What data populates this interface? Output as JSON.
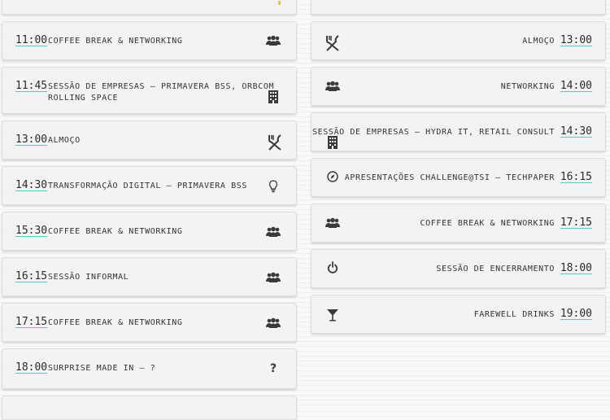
{
  "left": [
    {
      "time": "",
      "label": ""
    },
    {
      "time": "11:00",
      "label": "coffee break & networking",
      "icon": "group-icon"
    },
    {
      "time": "11:45",
      "label_line1": "sessão de empresas – primavera bss, orbcom",
      "label_line2": "rolling space",
      "icon": "building-icon"
    },
    {
      "time": "13:00",
      "label": "almoço",
      "icon": "cutlery-icon"
    },
    {
      "time": "14:30",
      "label": "transformação digital – primavera bss",
      "icon": "lightbulb-icon"
    },
    {
      "time": "15:30",
      "label": "coffee break & networking",
      "icon": "group-icon"
    },
    {
      "time": "16:15",
      "label": "sessão informal",
      "icon": "group-icon"
    },
    {
      "time": "17:15",
      "label": "coffee break & networking",
      "icon": "group-icon"
    },
    {
      "time": "18:00",
      "label": "surprise made in – ?",
      "icon": "question-icon"
    }
  ],
  "right": [
    {
      "time": "13:00",
      "label": "almoço",
      "icon": "cutlery-icon"
    },
    {
      "time": "14:00",
      "label": "networking",
      "icon": "group-icon"
    },
    {
      "time": "14:30",
      "label": "sessão de empresas – hydra it, retail consult",
      "icon": "building-icon"
    },
    {
      "time": "16:15",
      "label": "apresentações challenge@tsi – techpaper",
      "icon": "compass-icon"
    },
    {
      "time": "17:15",
      "label": "coffee break & networking",
      "icon": "group-icon"
    },
    {
      "time": "18:00",
      "label": "sessão de encerramento",
      "icon": "power-icon"
    },
    {
      "time": "19:00",
      "label": "farewell drinks",
      "icon": "cocktail-icon"
    }
  ]
}
